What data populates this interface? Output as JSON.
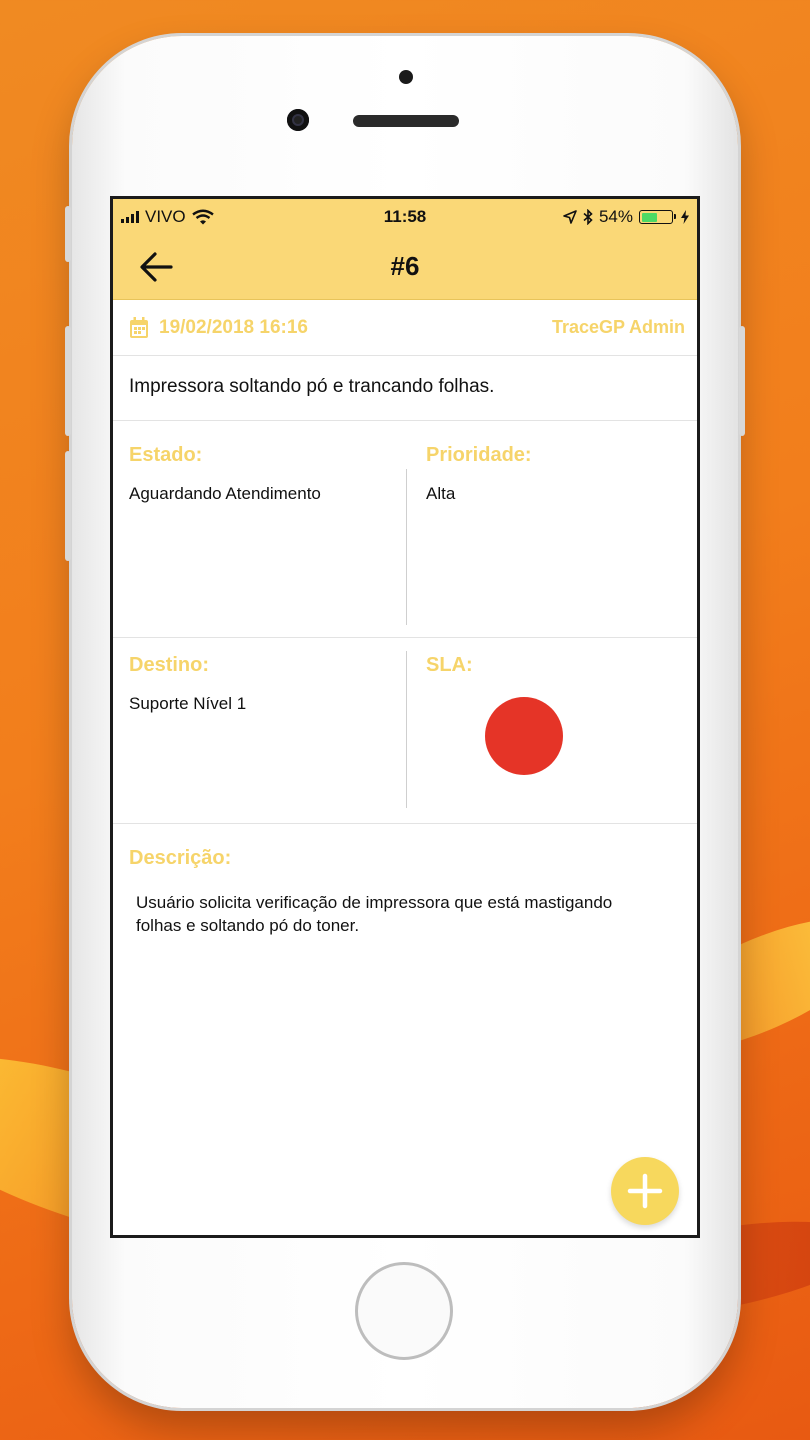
{
  "status_bar": {
    "carrier": "VIVO",
    "time": "11:58",
    "battery_percent": "54%",
    "battery_level": 0.54,
    "icons": [
      "signal-icon",
      "wifi-icon",
      "location-icon",
      "bluetooth-icon",
      "battery-icon",
      "charging-icon"
    ]
  },
  "header": {
    "title": "#6",
    "back_icon": "arrow-left-icon",
    "background": "#fad877"
  },
  "ticket": {
    "date": "19/02/2018 16:16",
    "date_icon": "calendar-icon",
    "user": "TraceGP Admin",
    "summary": "Impressora soltando pó e trancando folhas.",
    "estado_label": "Estado:",
    "estado_value": "Aguardando Atendimento",
    "prioridade_label": "Prioridade:",
    "prioridade_value": "Alta",
    "destino_label": "Destino:",
    "destino_value": "Suporte Nível 1",
    "sla_label": "SLA:",
    "sla_color": "#e53427",
    "descricao_label": "Descrição:",
    "descricao_value": "Usuário solicita verificação de impressora que está mastigando folhas e soltando pó do toner."
  },
  "fab": {
    "icon": "plus-icon",
    "color": "#f7d85d"
  },
  "colors": {
    "accent": "#f6d46a",
    "background": "#f27e1c"
  }
}
